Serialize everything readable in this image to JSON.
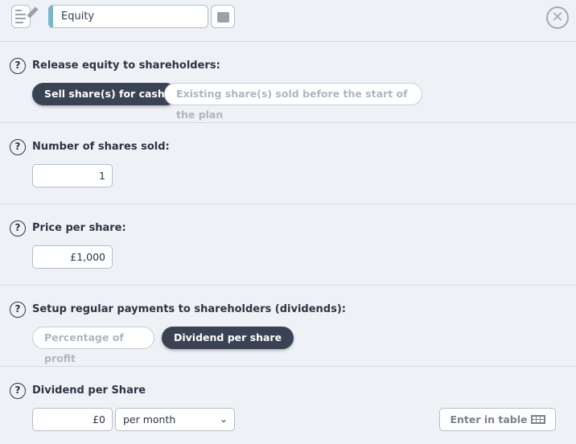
{
  "header": {
    "title_value": "Equity",
    "close_symbol": "✕"
  },
  "sections": {
    "release": {
      "label": "Release equity to shareholders:",
      "options": [
        "Sell share(s) for cash",
        "Existing share(s) sold before the start of the plan"
      ],
      "selected": "Sell share(s) for cash"
    },
    "shares_sold": {
      "label": "Number of shares sold:",
      "value": "1"
    },
    "price": {
      "label": "Price per share:",
      "value": "£1,000"
    },
    "dividends": {
      "label": "Setup regular payments to shareholders (dividends):",
      "options": [
        "Percentage of profit",
        "Dividend per share"
      ],
      "selected": "Dividend per share"
    },
    "dividend_per_share": {
      "label": "Dividend per Share",
      "value": "£0",
      "period": "per month",
      "table_button": "Enter in table"
    }
  },
  "help_symbol": "?",
  "colors": {
    "accent": "#7bb7c9",
    "active_pill": "#3a4354",
    "background": "#eef2f6"
  }
}
